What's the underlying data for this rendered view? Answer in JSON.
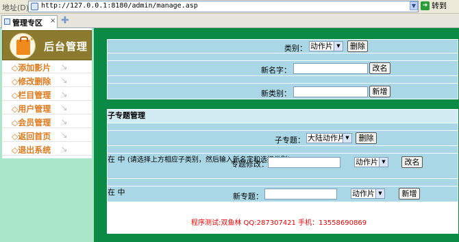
{
  "browser": {
    "address_label": "地址(D)",
    "url": "http://127.0.0.1:8180/admin/manage.asp",
    "go_label": "转到",
    "tab_label": "管理专区",
    "tab_close": "×",
    "new_tab": "✚"
  },
  "sidebar": {
    "title": "后台管理",
    "items": [
      {
        "label": "添加影片"
      },
      {
        "label": "修改删除"
      },
      {
        "label": "栏目管理"
      },
      {
        "label": "用户管理"
      },
      {
        "label": "会员管理"
      },
      {
        "label": "返回首页"
      },
      {
        "label": "退出系统"
      }
    ]
  },
  "category_panel": {
    "category_label": "类别：",
    "category_value": "动作片",
    "delete_button": "删除",
    "new_name_label": "新名字：",
    "new_name_value": "",
    "rename_button": "改名",
    "new_category_label": "新类别：",
    "new_category_value": "",
    "add_button": "新增"
  },
  "subtopic_panel": {
    "title": "子专题管理",
    "subtopic_label": "子专题：",
    "subtopic_value": "大陆动作片",
    "delete_button": "删除",
    "modify_label": "专题修改：",
    "modify_value": "",
    "in_label": "在",
    "modify_category_value": "动作片",
    "middle_label": "中",
    "rename_button": "改名",
    "hint": "(请选择上方相应子类别，然后输入新名字和选择类别)",
    "new_topic_label": "新专题：",
    "new_topic_value": "",
    "new_category_value": "动作片",
    "add_button": "新增"
  },
  "footer": {
    "text": "程序测试:双鱼林 QQ:287307421 手机：13558690869"
  }
}
